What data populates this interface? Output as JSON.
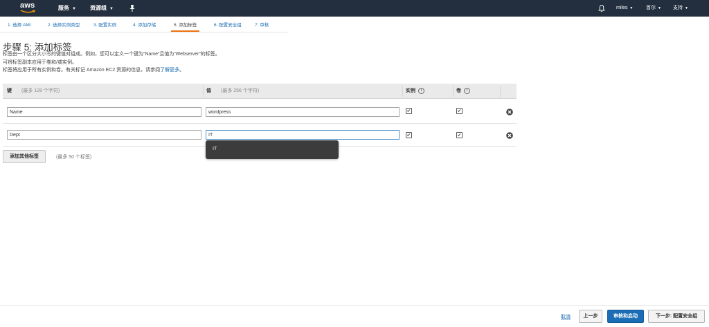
{
  "header": {
    "logo_text": "aws",
    "services_label": "服务",
    "resource_groups_label": "资源组",
    "user_label": "miles",
    "region_label": "首尔",
    "support_label": "支持"
  },
  "steps": [
    {
      "label": "1. 选择 AMI"
    },
    {
      "label": "2. 选择实例类型"
    },
    {
      "label": "3. 配置实例"
    },
    {
      "label": "4. 添加存储"
    },
    {
      "label": "5. 添加标签"
    },
    {
      "label": "6. 配置安全组"
    },
    {
      "label": "7. 审核"
    }
  ],
  "page": {
    "title": "步骤 5: 添加标签",
    "desc1": "标签由一个区分大小写的键值对组成。例如，您可以定义一个键为“Name”且值为“Webserver”的标签。",
    "desc2": "可将标签副本应用于卷和/或实例。",
    "desc3_prefix": "标签将应用于所有实例和卷。有关标记 Amazon EC2 资源的信息，请参阅",
    "desc3_link": "了解更多",
    "desc3_suffix": "。"
  },
  "table": {
    "key_header": "键",
    "key_hint": "(最多 128 个字符)",
    "value_header": "值",
    "value_hint": "(最多 256 个字符)",
    "instances_header": "实例",
    "volumes_header": "卷",
    "info_glyph": "i",
    "rows": [
      {
        "key": "Name",
        "value": "wordpress",
        "instances": true,
        "volumes": true
      },
      {
        "key": "Dept",
        "value": "IT",
        "instances": true,
        "volumes": true
      }
    ]
  },
  "autocomplete": {
    "options": [
      "IT"
    ]
  },
  "add_tag": {
    "button_label": "添加其他标签",
    "hint": "(最多 50 个标签)"
  },
  "footer": {
    "cancel_label": "取消",
    "previous_label": "上一步",
    "review_launch_label": "审核和启动",
    "next_label": "下一步: 配置安全组"
  },
  "colors": {
    "navbar": "#232f3e",
    "link": "#1b6eb5",
    "active_tab": "#ec7211",
    "primary_button": "#1b6eb5"
  }
}
